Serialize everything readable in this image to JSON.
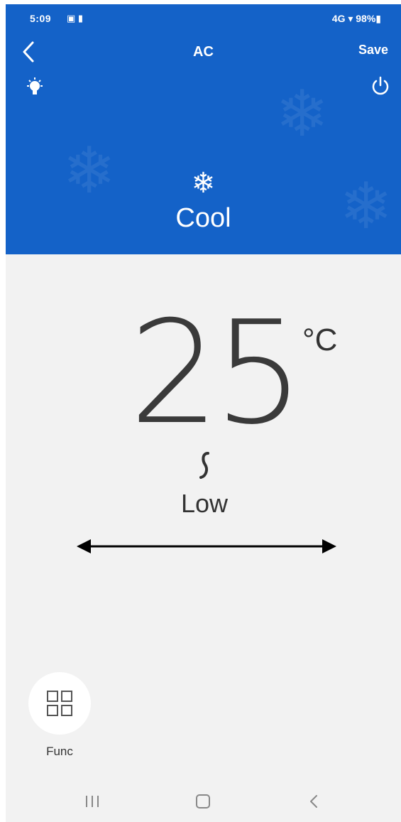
{
  "status_bar": {
    "time": "5:09",
    "left_icons": "▣ ▮",
    "right_text": "4G ▾ 98%▮"
  },
  "header": {
    "title": "AC",
    "save_label": "Save",
    "background_color": "#1462c8"
  },
  "mode": {
    "icon": "snowflake-icon",
    "icon_glyph": "❄",
    "label": "Cool"
  },
  "temperature": {
    "value": "25",
    "unit": "°C"
  },
  "fan": {
    "icon": "fan-speed-icon",
    "label": "Low"
  },
  "swing": {
    "icon": "horizontal-swing-arrow-icon"
  },
  "func": {
    "icon": "grid-icon",
    "label": "Func"
  },
  "nav": {
    "recent": "recent-apps-icon",
    "home": "home-icon",
    "back": "back-icon"
  }
}
